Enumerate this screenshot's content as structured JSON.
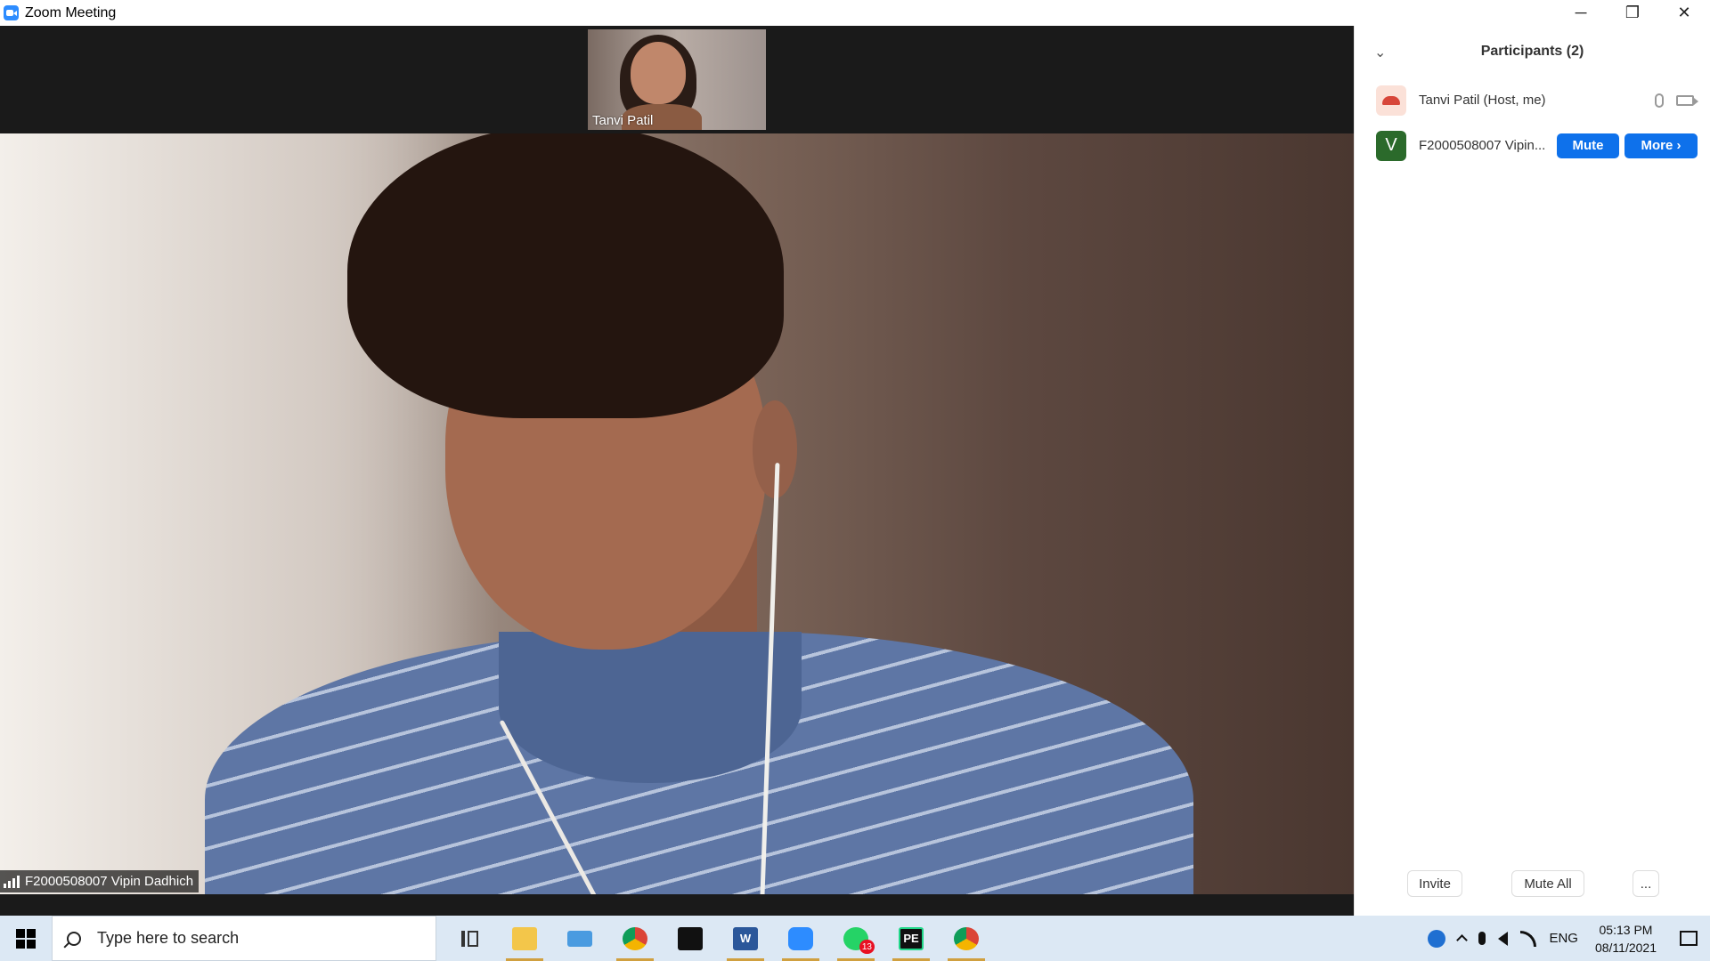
{
  "window": {
    "title": "Zoom Meeting",
    "minimize": "─",
    "restore": "❐",
    "close": "✕"
  },
  "meeting": {
    "thumbnail": {
      "name": "Tanvi Patil"
    },
    "main_video": {
      "name": "F2000508007 Vipin Dadhich"
    }
  },
  "participants_panel": {
    "collapse_glyph": "⌄",
    "title": "Participants (2)",
    "participants": [
      {
        "name": "Tanvi Patil (Host, me)",
        "avatar": "image"
      },
      {
        "name": "F2000508007 Vipin...",
        "avatar_letter": "V",
        "mute_label": "Mute",
        "more_label": "More ›"
      }
    ],
    "footer": {
      "invite": "Invite",
      "mute_all": "Mute All",
      "more": "..."
    }
  },
  "taskbar": {
    "search_placeholder": "Type here to search",
    "apps": [
      {
        "name": "task-view-icon"
      },
      {
        "name": "file-explorer-icon"
      },
      {
        "name": "this-pc-icon"
      },
      {
        "name": "chrome-icon"
      },
      {
        "name": "photos-icon"
      },
      {
        "name": "word-icon",
        "label": "W"
      },
      {
        "name": "zoom-icon"
      },
      {
        "name": "whatsapp-icon",
        "badge": "13"
      },
      {
        "name": "pycharm-icon",
        "label": "PE"
      },
      {
        "name": "chrome-profile-icon"
      }
    ],
    "tray": {
      "language": "ENG",
      "time": "05:13 PM",
      "date": "08/11/2021"
    }
  },
  "colors": {
    "zoom_blue": "#0e71eb",
    "taskbar": "#dce8f4",
    "avatar_green": "#2b6a2b"
  }
}
